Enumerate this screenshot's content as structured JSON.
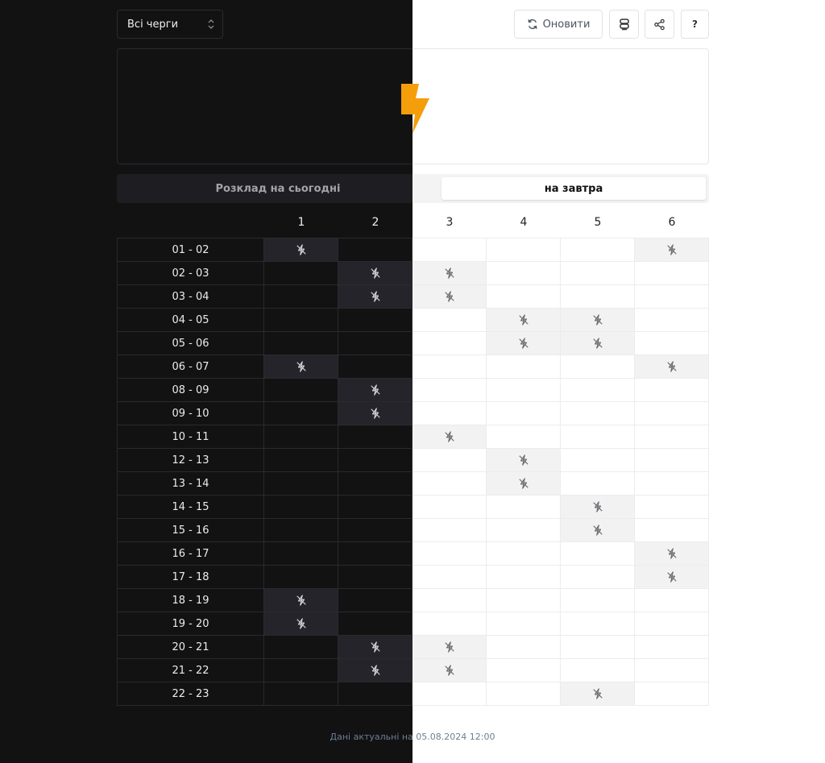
{
  "toolbar": {
    "queue_select_value": "Всі черги",
    "refresh_label": "Оновити",
    "help_label": "?"
  },
  "tabs": {
    "today": "Розклад на сьогодні",
    "tomorrow": "на завтра"
  },
  "colors": {
    "dark_bg": "#121213",
    "light_bg": "#ffffff",
    "accent_bolt": "#f59e0b",
    "outage_cell_dark": "#24242a",
    "outage_cell_light": "#f2f2f3"
  },
  "schedule": {
    "queues": [
      "1",
      "2",
      "3",
      "4",
      "5",
      "6"
    ],
    "rows": [
      {
        "slot": "01 - 02",
        "off": [
          1,
          6
        ]
      },
      {
        "slot": "02 - 03",
        "off": [
          2,
          3
        ]
      },
      {
        "slot": "03 - 04",
        "off": [
          2,
          3
        ]
      },
      {
        "slot": "04 - 05",
        "off": [
          4,
          5
        ]
      },
      {
        "slot": "05 - 06",
        "off": [
          4,
          5
        ]
      },
      {
        "slot": "06 - 07",
        "off": [
          1,
          6
        ]
      },
      {
        "slot": "08 - 09",
        "off": [
          2
        ]
      },
      {
        "slot": "09 - 10",
        "off": [
          2
        ]
      },
      {
        "slot": "10 - 11",
        "off": [
          3
        ]
      },
      {
        "slot": "12 - 13",
        "off": [
          4
        ]
      },
      {
        "slot": "13 - 14",
        "off": [
          4
        ]
      },
      {
        "slot": "14 - 15",
        "off": [
          5
        ]
      },
      {
        "slot": "15 - 16",
        "off": [
          5
        ]
      },
      {
        "slot": "16 - 17",
        "off": [
          6
        ]
      },
      {
        "slot": "17 - 18",
        "off": [
          6
        ]
      },
      {
        "slot": "18 - 19",
        "off": [
          1
        ]
      },
      {
        "slot": "19 - 20",
        "off": [
          1
        ]
      },
      {
        "slot": "20 - 21",
        "off": [
          2,
          3
        ]
      },
      {
        "slot": "21 - 22",
        "off": [
          2,
          3
        ]
      },
      {
        "slot": "22 - 23",
        "off": [
          5
        ]
      }
    ]
  },
  "footer": {
    "text": "Дані актуальні на 05.08.2024 12:00"
  }
}
